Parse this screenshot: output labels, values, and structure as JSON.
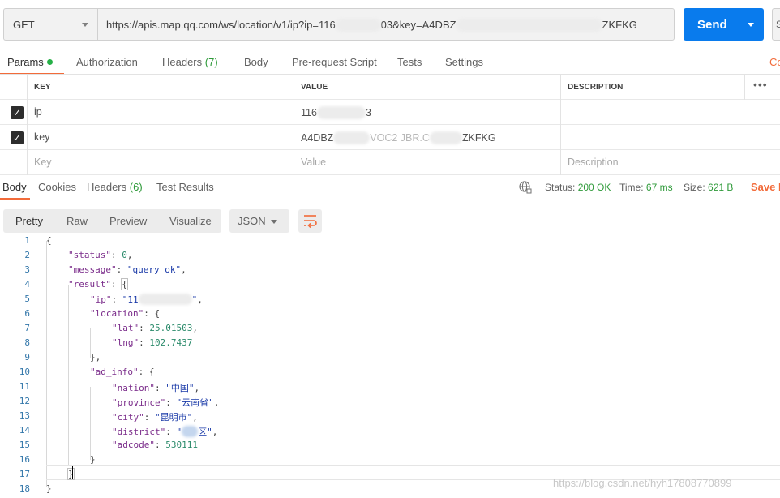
{
  "request": {
    "method": "GET",
    "url_prefix": "https://apis.map.qq.com/ws/location/v1/ip?ip=116",
    "url_mid": "03&key=A4DBZ",
    "url_suffix": "ZKFKG",
    "send_label": "Send",
    "save_label": "S"
  },
  "request_tabs": {
    "params": "Params",
    "authorization": "Authorization",
    "headers": "Headers",
    "headers_count": "(7)",
    "body": "Body",
    "prerequest": "Pre-request Script",
    "tests": "Tests",
    "settings": "Settings",
    "cookies_cut": "Co"
  },
  "params_table": {
    "headers": {
      "key": "KEY",
      "value": "VALUE",
      "description": "DESCRIPTION"
    },
    "rows": [
      {
        "key": "ip",
        "value_prefix": "116",
        "value_suffix": "3",
        "description": ""
      },
      {
        "key": "key",
        "value_prefix": "A4DBZ",
        "value_mid": "VOC2 JBR.C",
        "value_suffix": "ZKFKG",
        "description": ""
      }
    ],
    "placeholders": {
      "key": "Key",
      "value": "Value",
      "description": "Description"
    }
  },
  "response_tabs": {
    "body": "Body",
    "cookies": "Cookies",
    "headers": "Headers",
    "headers_count": "(6)",
    "test_results": "Test Results"
  },
  "response_status": {
    "status_label": "Status:",
    "status_value": "200 OK",
    "time_label": "Time:",
    "time_value": "67 ms",
    "size_label": "Size:",
    "size_value": "621 B",
    "save_label": "Save R"
  },
  "view": {
    "pretty": "Pretty",
    "raw": "Raw",
    "preview": "Preview",
    "visualize": "Visualize",
    "format": "JSON"
  },
  "code_lines": [
    {
      "n": "1",
      "text": "{"
    },
    {
      "n": "2",
      "key": "\"status\"",
      "sep": ": ",
      "num": "0",
      "end": ","
    },
    {
      "n": "3",
      "key": "\"message\"",
      "sep": ": ",
      "str": "\"query ok\"",
      "end": ","
    },
    {
      "n": "4",
      "key": "\"result\"",
      "sep": ": ",
      "end": "{"
    },
    {
      "n": "5",
      "key": "\"ip\"",
      "sep": ": ",
      "str": "\"11",
      "str2": "\"",
      "end": ","
    },
    {
      "n": "6",
      "key": "\"location\"",
      "sep": ": ",
      "end": "{"
    },
    {
      "n": "7",
      "key": "\"lat\"",
      "sep": ": ",
      "num": "25.01503",
      "end": ","
    },
    {
      "n": "8",
      "key": "\"lng\"",
      "sep": ": ",
      "num": "102.7437",
      "end": ""
    },
    {
      "n": "9",
      "text": "},"
    },
    {
      "n": "10",
      "key": "\"ad_info\"",
      "sep": ": ",
      "end": "{"
    },
    {
      "n": "11",
      "key": "\"nation\"",
      "sep": ": ",
      "str": "\"中国\"",
      "end": ","
    },
    {
      "n": "12",
      "key": "\"province\"",
      "sep": ": ",
      "str": "\"云南省\"",
      "end": ","
    },
    {
      "n": "13",
      "key": "\"city\"",
      "sep": ": ",
      "str": "\"昆明市\"",
      "end": ","
    },
    {
      "n": "14",
      "key": "\"district\"",
      "sep": ": ",
      "str": "\"",
      "str2": "区\"",
      "end": ","
    },
    {
      "n": "15",
      "key": "\"adcode\"",
      "sep": ": ",
      "num": "530111",
      "end": ""
    },
    {
      "n": "16",
      "text": "}"
    },
    {
      "n": "17",
      "text": "}"
    },
    {
      "n": "18",
      "text": "}"
    }
  ],
  "watermark": "https://blog.csdn.net/hyh17808770899",
  "colors": {
    "send": "#097bed",
    "accent": "#f26b3a",
    "status_ok": "#2f9a3a",
    "json_key": "#7a2b8a",
    "json_string": "#1a3aa8",
    "json_number": "#2a8a6a"
  }
}
